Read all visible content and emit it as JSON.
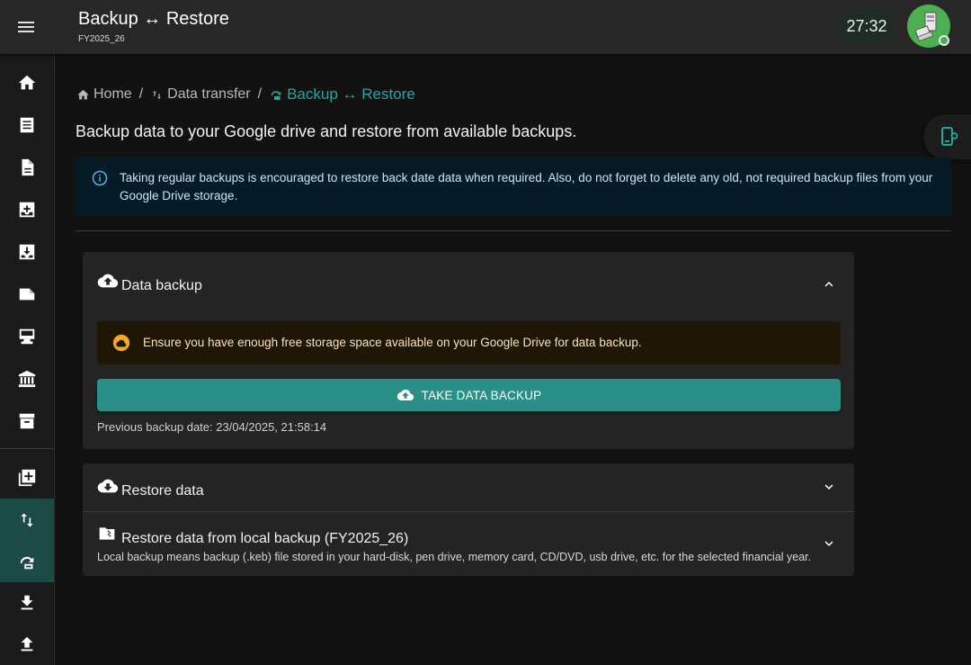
{
  "appbar": {
    "title": "Backup ↔ Restore",
    "subtitle": "FY2025_26",
    "timer": "27:32",
    "menu_icon": "menu-icon",
    "avatar_icon": "user-computer-icon",
    "status_color": "#4caf50"
  },
  "rail": {
    "items": [
      {
        "icon": "home-icon"
      },
      {
        "icon": "list-icon"
      },
      {
        "icon": "document-icon"
      },
      {
        "icon": "inbox-add-icon"
      },
      {
        "icon": "inbox-download-icon"
      },
      {
        "icon": "label-icon"
      },
      {
        "icon": "point-of-sale-icon"
      },
      {
        "icon": "bank-icon"
      },
      {
        "icon": "archive-icon"
      },
      {
        "icon": "add-box-icon"
      },
      {
        "icon": "swap-vert-icon",
        "active": true
      },
      {
        "icon": "backup-restore-icon"
      },
      {
        "icon": "download-icon"
      },
      {
        "icon": "upload-icon"
      }
    ]
  },
  "breadcrumb": {
    "home": "Home",
    "data_transfer": "Data transfer",
    "current": "Backup ↔ Restore",
    "separator": "/"
  },
  "page": {
    "description": "Backup data to your Google drive and restore from available backups."
  },
  "info_alert": {
    "text": "Taking regular backups is encouraged to restore back date data when required. Also, do not forget to delete any old, not required backup files from your Google Drive storage."
  },
  "data_backup": {
    "title": "Data backup",
    "warning": "Ensure you have enough free storage space available on your Google Drive for data backup.",
    "button_label": "TAKE DATA BACKUP",
    "previous_backup": "Previous backup date: 23/04/2025, 21:58:14",
    "expanded": true
  },
  "restore_data": {
    "title": "Restore data",
    "expanded": false
  },
  "local_restore": {
    "title": "Restore data from local backup (FY2025_26)",
    "subtitle": "Local backup means backup (.keb) file stored in your hard-disk, pen drive, memory card, CD/DVD, usb drive, etc. for the selected financial year.",
    "expanded": false
  },
  "colors": {
    "accent": "#26a69a",
    "button": "#2a8f87",
    "info_bg": "#071b26",
    "warning_bg": "#1f1606",
    "warning_icon": "#f5a623",
    "rail_active": "#1c4a47"
  }
}
